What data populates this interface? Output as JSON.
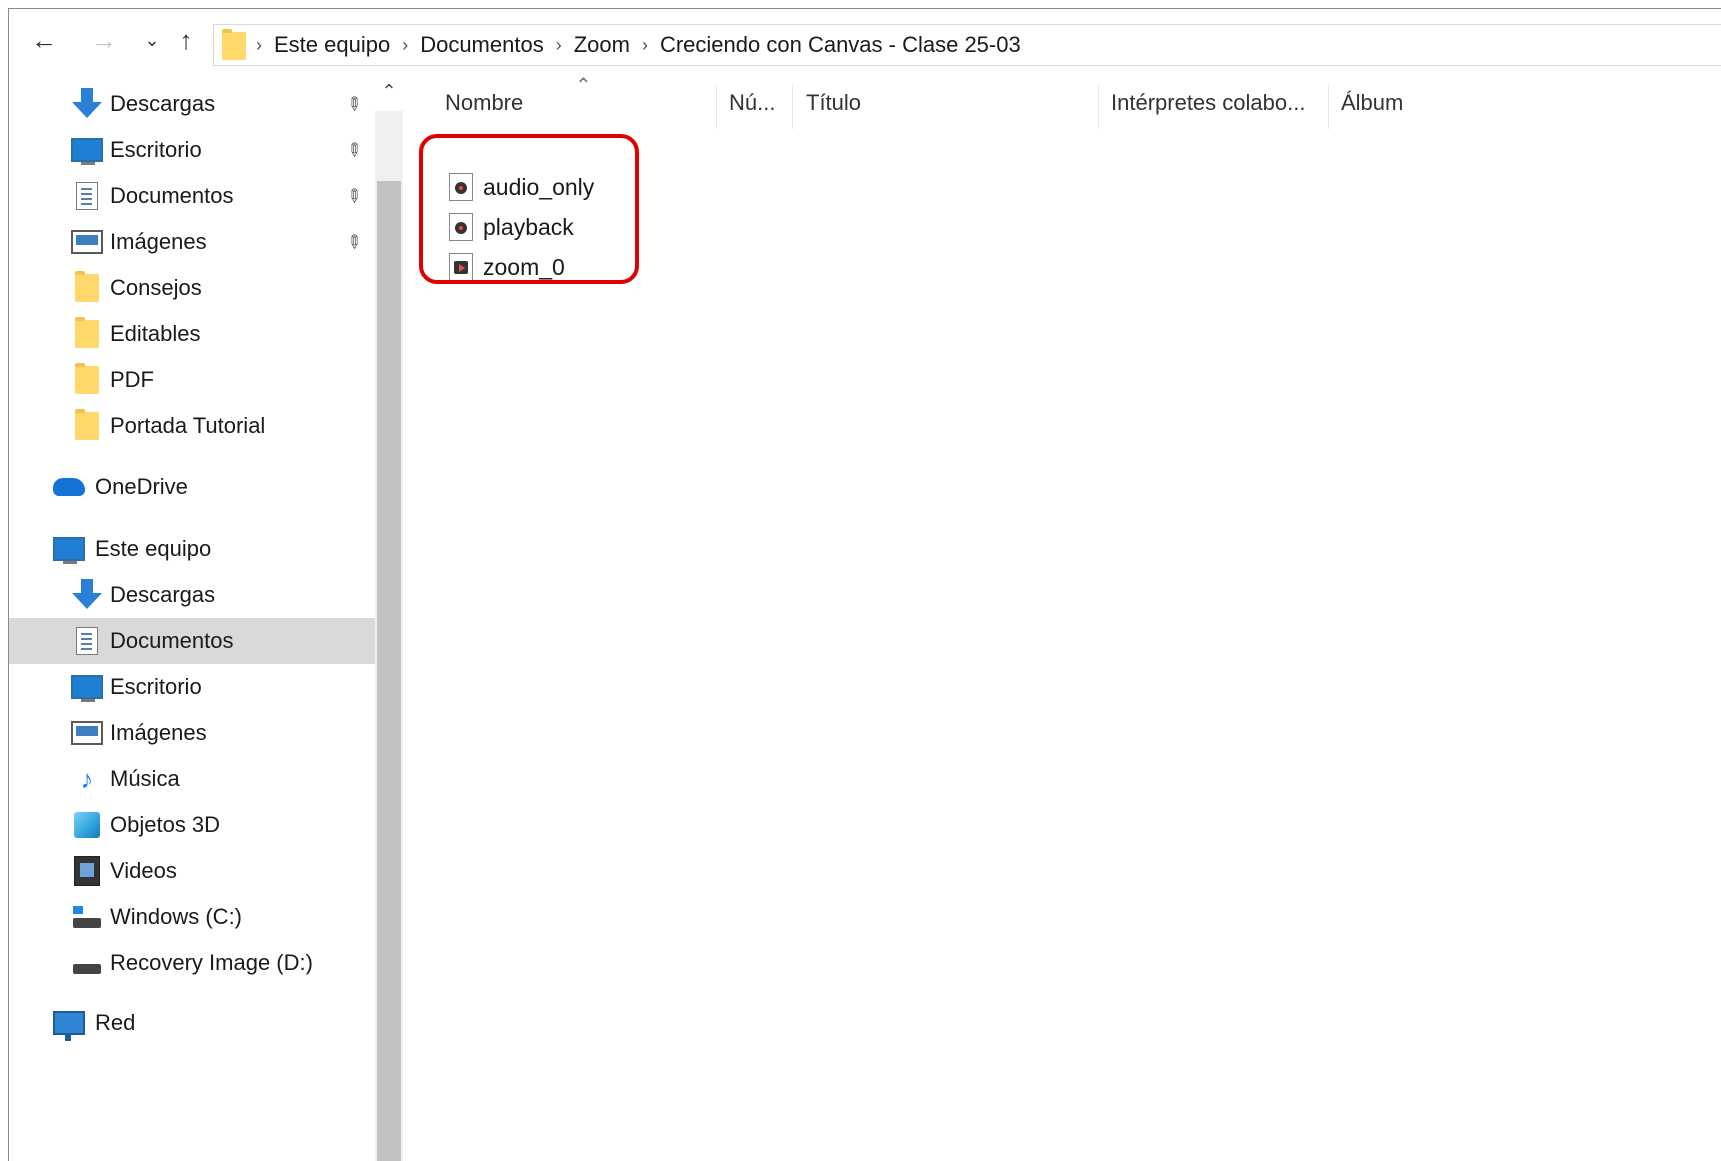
{
  "address_bar": {
    "breadcrumbs": [
      "Este equipo",
      "Documentos",
      "Zoom",
      "Creciendo con Canvas - Clase 25-03"
    ],
    "separator": "›"
  },
  "nav_buttons": {
    "back": "←",
    "forward": "→",
    "recent": "⌄",
    "up": "↑"
  },
  "quick_access": [
    {
      "label": "Descargas",
      "icon": "download-icon",
      "pinned": true
    },
    {
      "label": "Escritorio",
      "icon": "desktop-icon",
      "pinned": true
    },
    {
      "label": "Documentos",
      "icon": "document-icon",
      "pinned": true
    },
    {
      "label": "Imágenes",
      "icon": "pictures-icon",
      "pinned": true
    },
    {
      "label": "Consejos",
      "icon": "folder-icon",
      "pinned": false
    },
    {
      "label": "Editables",
      "icon": "folder-icon",
      "pinned": false
    },
    {
      "label": "PDF",
      "icon": "folder-icon",
      "pinned": false
    },
    {
      "label": "Portada Tutorial",
      "icon": "folder-icon",
      "pinned": false
    }
  ],
  "onedrive": {
    "label": "OneDrive",
    "icon": "cloud-icon"
  },
  "this_pc": {
    "label": "Este equipo",
    "icon": "computer-icon"
  },
  "this_pc_items": [
    {
      "label": "Descargas",
      "icon": "download-icon"
    },
    {
      "label": "Documentos",
      "icon": "document-icon",
      "selected": true
    },
    {
      "label": "Escritorio",
      "icon": "desktop-icon"
    },
    {
      "label": "Imágenes",
      "icon": "pictures-icon"
    },
    {
      "label": "Música",
      "icon": "music-icon"
    },
    {
      "label": "Objetos 3D",
      "icon": "3d-objects-icon"
    },
    {
      "label": "Videos",
      "icon": "videos-icon"
    },
    {
      "label": "Windows (C:)",
      "icon": "drive-c-icon"
    },
    {
      "label": "Recovery Image (D:)",
      "icon": "drive-d-icon"
    }
  ],
  "network": {
    "label": "Red",
    "icon": "network-icon"
  },
  "columns": [
    "Nombre",
    "Nú...",
    "Título",
    "Intérpretes colabo...",
    "Álbum"
  ],
  "files": [
    {
      "name": "audio_only",
      "icon": "audio-file-icon"
    },
    {
      "name": "playback",
      "icon": "audio-file-icon"
    },
    {
      "name": "zoom_0",
      "icon": "video-file-icon"
    }
  ],
  "highlight_color": "#e00000",
  "selected_bg": "#d9d9d9"
}
